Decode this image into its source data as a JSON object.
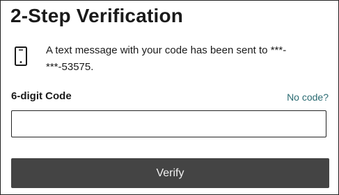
{
  "header": {
    "title": "2-Step Verification"
  },
  "message": {
    "icon": "mobile-phone-icon",
    "text": "A text message with your code has been sent to ***-***-53575."
  },
  "code_field": {
    "label": "6-digit Code",
    "help_link": "No code?",
    "value": "",
    "placeholder": ""
  },
  "actions": {
    "verify_label": "Verify"
  },
  "colors": {
    "link": "#2a6b72",
    "button_bg": "#444444",
    "button_text": "#f2f2f2",
    "text": "#1a1a1a"
  }
}
